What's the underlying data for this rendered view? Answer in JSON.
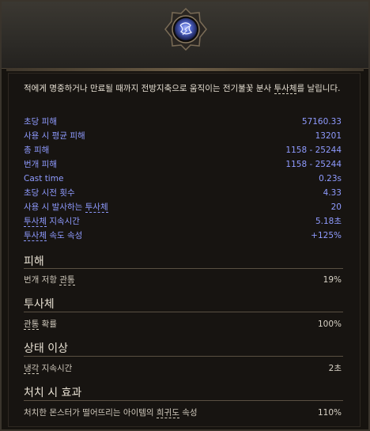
{
  "description": {
    "prefix": "적에게 명중하거나 만료될 때까지 전방지축으로 움직이는 전기불꽃 분사 ",
    "link": "투사체",
    "suffix": "를 날립니다."
  },
  "stats": [
    {
      "label": "초당 피해",
      "value": "57160.33"
    },
    {
      "label": "사용 시 평균 피해",
      "value": "13201"
    },
    {
      "label": "총 피해",
      "value": "1158 - 25244"
    },
    {
      "label": "번개 피해",
      "value": "1158 - 25244"
    },
    {
      "label": "Cast time",
      "value": "0.23s"
    },
    {
      "label": "초당 시전 횟수",
      "value": "4.33"
    },
    {
      "label_prefix": "사용 시 발사하는 ",
      "label_link": "투사체",
      "value": "20"
    },
    {
      "label_link": "투사체",
      "label_suffix": " 지속시간",
      "value": "5.18초"
    },
    {
      "label_link": "투사체",
      "label_suffix": " 속도 속성",
      "value": "+125%"
    }
  ],
  "sections": [
    {
      "title": "피해",
      "rows": [
        {
          "label_prefix": "번개 저항 ",
          "label_link": "관통",
          "value": "19%"
        }
      ]
    },
    {
      "title": "투사체",
      "rows": [
        {
          "label_link": "관통",
          "label_suffix": " 확률",
          "value": "100%"
        }
      ]
    },
    {
      "title": "상태 이상",
      "rows": [
        {
          "label_link": "냉각",
          "label_suffix": " 지속시간",
          "value": "2초"
        }
      ]
    },
    {
      "title": "처치 시 효과",
      "rows": [
        {
          "label_prefix": "처치한 몬스터가 떨어뜨리는 아이템의 ",
          "label_link": "희귀도",
          "label_suffix": " 속성",
          "value": "110%"
        }
      ]
    }
  ],
  "emblem": {
    "icon": "lightning-orb-icon"
  },
  "colors": {
    "stat_text": "#8f9bff",
    "body_text": "#cfc8bb",
    "panel_bg": "#171411"
  }
}
